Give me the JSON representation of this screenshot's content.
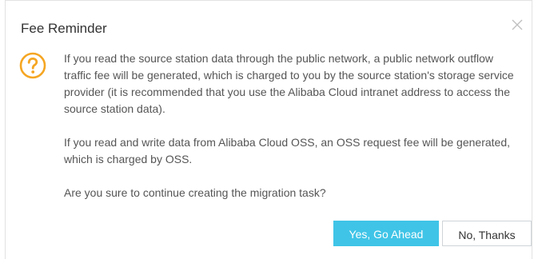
{
  "dialog": {
    "title": "Fee Reminder",
    "paragraphs": [
      "If you read the source station data through the public network, a public network outflow traffic fee will be generated, which is charged to you by the source station's storage service provider (it is recommended that you use the Alibaba Cloud intranet address to access the source station data).",
      "If you read and write data from Alibaba Cloud OSS, an OSS request fee will be generated, which is charged by OSS.",
      "Are you sure to continue creating the migration task?"
    ],
    "confirm_label": "Yes, Go Ahead",
    "cancel_label": "No, Thanks",
    "icons": {
      "close": "close-icon",
      "warning": "question-circle-icon"
    },
    "colors": {
      "accent": "#3fc4e7",
      "warning": "#f5a623"
    }
  }
}
